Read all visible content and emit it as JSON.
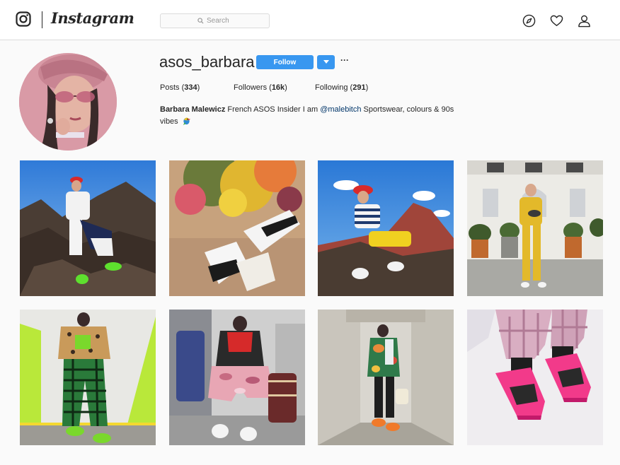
{
  "nav": {
    "wordmark": "Instagram",
    "search_placeholder": "Search",
    "icons": [
      "camera-logo-icon",
      "explore-compass-icon",
      "heart-icon",
      "profile-icon"
    ]
  },
  "profile": {
    "username": "asos_barbara",
    "follow_label": "Follow",
    "dropdown_icon": "caret-down-icon",
    "more_label": "···",
    "stats": {
      "posts_label": "Posts",
      "posts_count": "334",
      "followers_label": "Followers",
      "followers_count": "16k",
      "following_label": "Following",
      "following_count": "291"
    },
    "bio": {
      "name": "Barbara Malewicz",
      "text_before": " French ASOS Insider I am ",
      "mention": "@malebitch",
      "text_after": " Sportswear, colours & 90s vibes",
      "emoji": "parrot-emoji"
    }
  },
  "colors": {
    "accent": "#3897f0",
    "mention": "#003569",
    "border": "#dbdbdb",
    "background": "#fafafa"
  }
}
